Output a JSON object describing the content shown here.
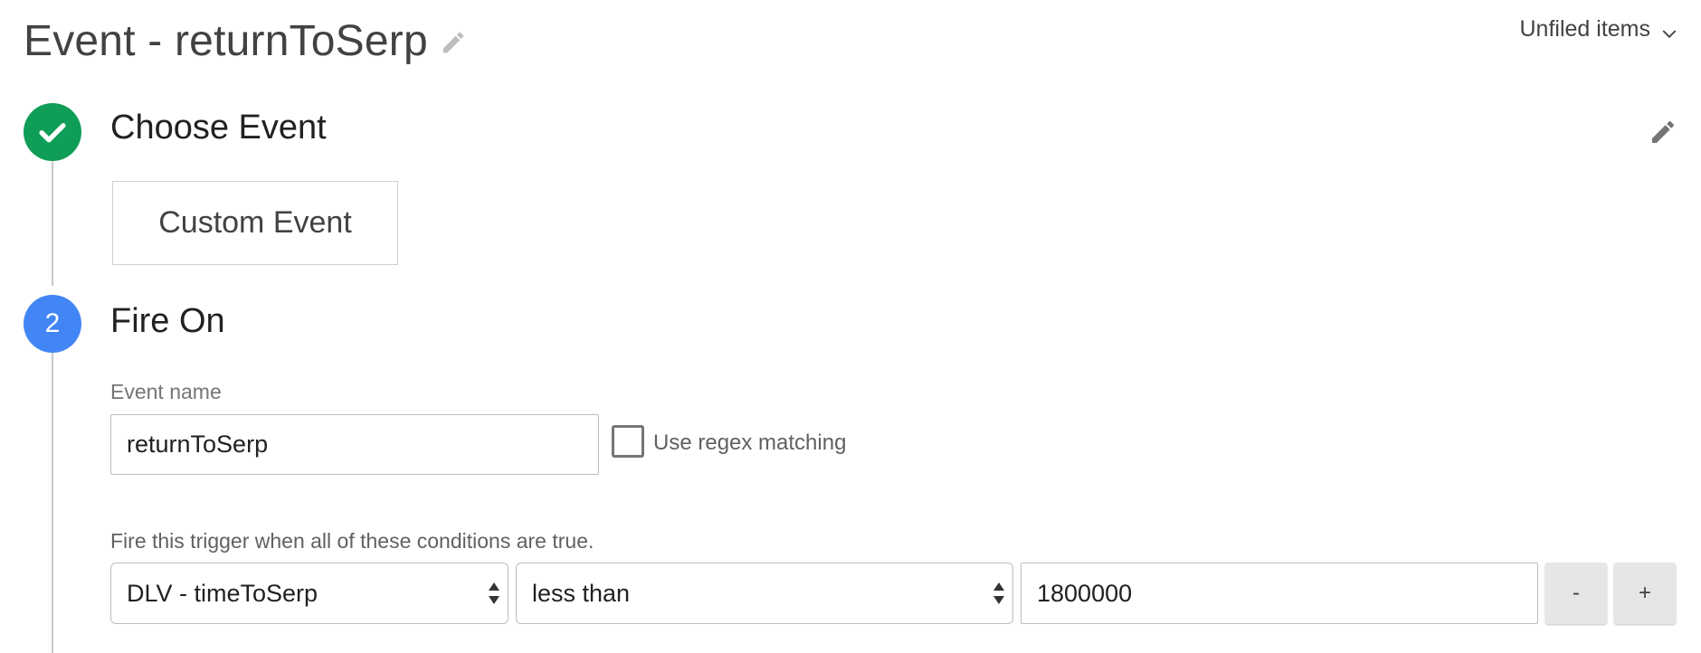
{
  "header": {
    "title": "Event - returnToSerp",
    "folder_label": "Unfiled items"
  },
  "steps": [
    {
      "title": "Choose Event",
      "status": "complete",
      "status_color": "#0f9d58",
      "selected_type": "Custom Event"
    },
    {
      "number": "2",
      "title": "Fire On",
      "status_color": "#4285f4",
      "event_name_label": "Event name",
      "event_name_value": "returnToSerp",
      "regex_label": "Use regex matching",
      "regex_checked": false,
      "conditions_label": "Fire this trigger when all of these conditions are true.",
      "condition": {
        "variable": "DLV - timeToSerp",
        "operator": "less than",
        "value": "1800000",
        "remove_label": "-",
        "add_label": "+"
      }
    }
  ],
  "icons": {
    "title_edit": "pencil-icon",
    "step_edit": "pencil-icon",
    "check": "checkmark-icon",
    "folder_dropdown": "chevron-down-icon",
    "select_arrows": "sort-arrows-icon"
  }
}
